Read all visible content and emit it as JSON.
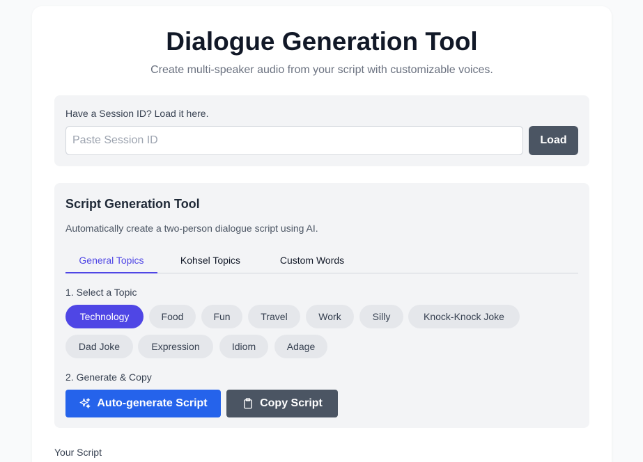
{
  "header": {
    "title": "Dialogue Generation Tool",
    "subtitle": "Create multi-speaker audio from your script with customizable voices."
  },
  "session": {
    "label": "Have a Session ID? Load it here.",
    "placeholder": "Paste Session ID",
    "value": "",
    "load_label": "Load"
  },
  "script_tool": {
    "title": "Script Generation Tool",
    "description": "Automatically create a two-person dialogue script using AI.",
    "tabs": [
      {
        "label": "General Topics",
        "active": true
      },
      {
        "label": "Kohsel Topics",
        "active": false
      },
      {
        "label": "Custom Words",
        "active": false
      }
    ],
    "step1_label": "1. Select a Topic",
    "topics": [
      {
        "label": "Technology",
        "selected": true
      },
      {
        "label": "Food",
        "selected": false
      },
      {
        "label": "Fun",
        "selected": false
      },
      {
        "label": "Travel",
        "selected": false
      },
      {
        "label": "Work",
        "selected": false
      },
      {
        "label": "Silly",
        "selected": false
      },
      {
        "label": "Knock-Knock Joke",
        "selected": false
      },
      {
        "label": "Dad Joke",
        "selected": false
      },
      {
        "label": "Expression",
        "selected": false
      },
      {
        "label": "Idiom",
        "selected": false
      },
      {
        "label": "Adage",
        "selected": false
      }
    ],
    "step2_label": "2. Generate & Copy",
    "generate_label": "Auto-generate Script",
    "generate_icon": "sparkles-icon",
    "copy_label": "Copy Script",
    "copy_icon": "clipboard-icon"
  },
  "script_section": {
    "label": "Your Script"
  },
  "colors": {
    "accent": "#4f46e5",
    "primary_button": "#2563eb",
    "secondary_button": "#4b5563",
    "panel": "#f3f4f6"
  }
}
